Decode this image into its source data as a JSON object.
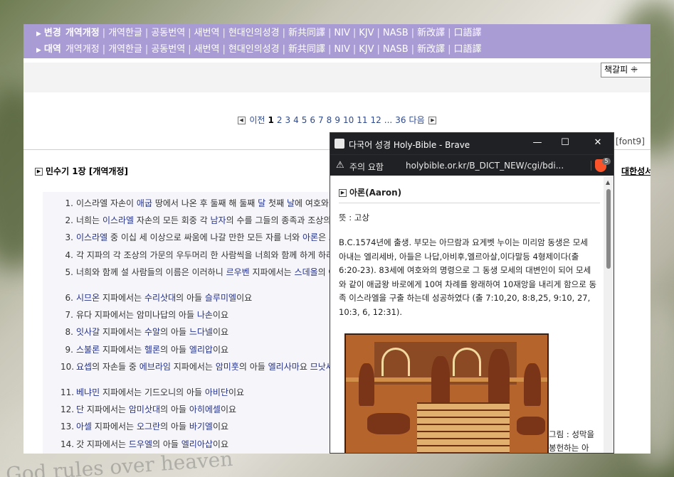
{
  "nav": {
    "row1": {
      "section": "변경",
      "current": "개역개정",
      "items": [
        "개역한글",
        "공동번역",
        "새번역",
        "현대인의성경",
        "新共同譯",
        "NIV",
        "KJV",
        "NASB",
        "新改譯",
        "口語譯"
      ]
    },
    "row2": {
      "section": "대역",
      "current": "개역개정",
      "items": [
        "개역한글",
        "공동번역",
        "새번역",
        "현대인의성경",
        "新共同譯",
        "NIV",
        "KJV",
        "NASB",
        "新改譯",
        "口語譯"
      ]
    }
  },
  "bookmark_button": "책갈피 ꔰ",
  "pager": {
    "prev": "이전",
    "pages": [
      "1",
      "2",
      "3",
      "4",
      "5",
      "6",
      "7",
      "8",
      "9",
      "10",
      "11",
      "12",
      "...",
      "36"
    ],
    "current": "1",
    "next": "다음"
  },
  "font_option": "[font9]",
  "chapter_title": "민수기 1장 [개역개정]",
  "right_link": "대한성서",
  "verses": [
    {
      "n": "1.",
      "parts": [
        [
          "t",
          "이스라엘 자손이 "
        ],
        [
          "l",
          "애굽"
        ],
        [
          "t",
          " 땅에서 나온 후 둘째 해 둘째 "
        ],
        [
          "l",
          "달"
        ],
        [
          "t",
          " 첫째 "
        ],
        [
          "l",
          "날"
        ],
        [
          "t",
          "에 여호와께서"
        ]
      ]
    },
    {
      "n": "2.",
      "parts": [
        [
          "t",
          "너희는 "
        ],
        [
          "l",
          "이스라엘"
        ],
        [
          "t",
          " 자손의 모든 회중 각 "
        ],
        [
          "l",
          "남자"
        ],
        [
          "t",
          "의 수를 그들의 종족과 조상의 가"
        ]
      ]
    },
    {
      "n": "3.",
      "parts": [
        [
          "l",
          "이스라엘"
        ],
        [
          "t",
          " 중 이십 세 이상으로 싸움에 나갈 만한 모든 자를 너와 "
        ],
        [
          "l",
          "아론"
        ],
        [
          "t",
          "은 그"
        ]
      ]
    },
    {
      "n": "4.",
      "parts": [
        [
          "t",
          "각 지파의 각 조상의 가문의 우두머리 한 사람씩을 너희와 함께 하게 하라"
        ]
      ]
    },
    {
      "n": "5.",
      "parts": [
        [
          "t",
          "너희와 함께 설 사람들의 이름은 이러하니 "
        ],
        [
          "l",
          "르우벤"
        ],
        [
          "t",
          " 지파에서는 "
        ],
        [
          "l",
          "스데올"
        ],
        [
          "t",
          "의 아"
        ]
      ]
    },
    {
      "n": "6.",
      "gap": true,
      "parts": [
        [
          "l",
          "시므온"
        ],
        [
          "t",
          " 지파에서는 "
        ],
        [
          "l",
          "수리삿대"
        ],
        [
          "t",
          "의 아들 "
        ],
        [
          "l",
          "슬루미엘"
        ],
        [
          "t",
          "이요"
        ]
      ]
    },
    {
      "n": "7.",
      "parts": [
        [
          "t",
          "유다 지파에서는 암미나답의 아들 "
        ],
        [
          "l",
          "나손"
        ],
        [
          "t",
          "이요"
        ]
      ]
    },
    {
      "n": "8.",
      "parts": [
        [
          "l",
          "잇사갈"
        ],
        [
          "t",
          " 지파에서는 "
        ],
        [
          "l",
          "수알"
        ],
        [
          "t",
          "의 아들 "
        ],
        [
          "l",
          "느다넬"
        ],
        [
          "t",
          "이요"
        ]
      ]
    },
    {
      "n": "9.",
      "parts": [
        [
          "l",
          "스불론"
        ],
        [
          "t",
          " 지파에서는 "
        ],
        [
          "l",
          "헬론"
        ],
        [
          "t",
          "의 아들 "
        ],
        [
          "l",
          "엘리압"
        ],
        [
          "t",
          "이요"
        ]
      ]
    },
    {
      "n": "10.",
      "parts": [
        [
          "l",
          "요셉"
        ],
        [
          "t",
          "의 자손들 중 "
        ],
        [
          "l",
          "에브라임"
        ],
        [
          "t",
          " 지파에서는 "
        ],
        [
          "l",
          "암미훗"
        ],
        [
          "t",
          "의 아들 "
        ],
        [
          "l",
          "엘리사마"
        ],
        [
          "t",
          "요 "
        ],
        [
          "l",
          "므낫세"
        ]
      ]
    },
    {
      "n": "11.",
      "gap": true,
      "parts": [
        [
          "l",
          "베냐민"
        ],
        [
          "t",
          " 지파에서는 기드오니의 아들 "
        ],
        [
          "l",
          "아비단"
        ],
        [
          "t",
          "이요"
        ]
      ]
    },
    {
      "n": "12.",
      "parts": [
        [
          "l",
          "단"
        ],
        [
          "t",
          " 지파에서는 "
        ],
        [
          "l",
          "암미삿대"
        ],
        [
          "t",
          "의 아들 "
        ],
        [
          "l",
          "아히에셀"
        ],
        [
          "t",
          "이요"
        ]
      ]
    },
    {
      "n": "13.",
      "parts": [
        [
          "l",
          "아셀"
        ],
        [
          "t",
          " 지파에서는 "
        ],
        [
          "l",
          "오그란"
        ],
        [
          "t",
          "의 아들 "
        ],
        [
          "l",
          "바기엘"
        ],
        [
          "t",
          "이요"
        ]
      ]
    },
    {
      "n": "14.",
      "parts": [
        [
          "t",
          "갓 지파에서는 "
        ],
        [
          "l",
          "드우엘"
        ],
        [
          "t",
          "의 아들 "
        ],
        [
          "l",
          "엘리아삽"
        ],
        [
          "t",
          "이요"
        ]
      ]
    }
  ],
  "popup": {
    "window_title": "다국어 성경 Holy-Bible - Brave",
    "warning_label": "주의 요함",
    "url": "holybible.or.kr/B_DICT_NEW/cgi/bdi...",
    "shield_count": "5",
    "heading": "아론(Aaron)",
    "meaning": "뜻 : 고상",
    "description": "B.C.1574년에 출생. 부모는 아므람과 요게벳 누이는 미리암 동생은 모세 아내는 엘리세바, 아들은 나답,아비후,엘르아살,이다말등 4형제이다(출 6:20-23). 83세에 여호와의 명령으로 그 동생 모세의 대변인이 되어 모세와 같이 애굽왕 바로에게 10여 차례를 왕래하여 10재앙을 내리게 함으로 동족 이스라엘을 구출 하는데 성공하였다 (출 7:10,20, 8:8,25, 9:10, 27, 10:3, 6, 12:31).",
    "caption": "그림 : 성막을 봉헌하는 아론 : 고대 바벨로니아의 두"
  },
  "background_text": "God rules over heaven",
  "colors": {
    "nav_bg": "#a99bd3",
    "link": "#24318a",
    "titlebar": "#202124",
    "brave": "#fb542b"
  }
}
